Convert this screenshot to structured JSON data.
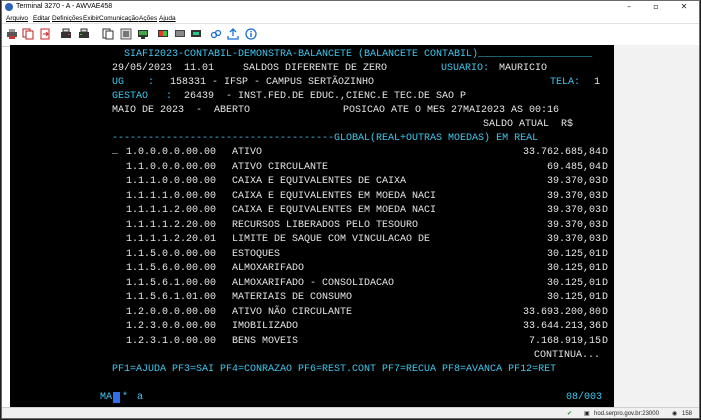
{
  "window": {
    "title": "Terminal 3270 - A - AWVAE458",
    "minimize": "–",
    "maximize": "▫",
    "close": "✕"
  },
  "menu": [
    {
      "label": "Arquivo"
    },
    {
      "label": "Editar"
    },
    {
      "label": "Definições"
    },
    {
      "label": "Exibir"
    },
    {
      "label": "Comunicação"
    },
    {
      "label": "Ações"
    },
    {
      "label": "Ajuda"
    }
  ],
  "toolbar": [
    "print-screen-icon",
    "copy-icon",
    "paste-icon",
    "send-icon",
    "receive-icon",
    "macro-icon",
    "keypad-icon",
    "display-icon",
    "color-icon",
    "settings-icon",
    "link-icon",
    "upload-icon",
    "help-icon"
  ],
  "terminal": {
    "header_line": "  SIAFI2023-CONTABIL-DEMONSTRA-BALANCETE (BALANCETE CONTABIL)___________________",
    "date_time": "29/05/2023  11.01",
    "report_title": "SALDOS DIFERENTE DE ZERO",
    "user_label": "USUARIO:",
    "user_name": "MAURICIO",
    "ug_label": "UG    :",
    "ug_value": "158331 - IFSP - CAMPUS SERTÃOZINHO",
    "screen_label": "TELA:",
    "screen_number": "1",
    "gestao_label": "GESTAO   :",
    "gestao_value": "26439  - INST.FED.DE EDUC.,CIENC.E TEC.DE SAO P",
    "period": "MAIO DE 2023  -  ABERTO",
    "position": "POSICAO ATE O MES 27MAI2023 AS 00:16",
    "balance_header": "SALDO ATUAL  R$",
    "global_line": "-------------------------------------GLOBAL(REAL+OUTRAS MOEDAS) EM REAL",
    "input_marker": "_",
    "rows": [
      {
        "code": "1.0.0.0.0.00.00",
        "name": "ATIVO",
        "value": "33.762.685,84",
        "dc": "D"
      },
      {
        "code": "1.1.0.0.0.00.00",
        "name": "ATIVO CIRCULANTE",
        "value": "69.485,04",
        "dc": "D"
      },
      {
        "code": "1.1.1.0.0.00.00",
        "name": "CAIXA E EQUIVALENTES DE CAIXA",
        "value": "39.370,03",
        "dc": "D"
      },
      {
        "code": "1.1.1.1.0.00.00",
        "name": "CAIXA E EQUIVALENTES EM MOEDA NACI",
        "value": "39.370,03",
        "dc": "D"
      },
      {
        "code": "1.1.1.1.2.00.00",
        "name": "CAIXA E EQUIVALENTES EM MOEDA NACI",
        "value": "39.370,03",
        "dc": "D"
      },
      {
        "code": "1.1.1.1.2.20.00",
        "name": "RECURSOS LIBERADOS PELO TESOURO",
        "value": "39.370,03",
        "dc": "D"
      },
      {
        "code": "1.1.1.1.2.20.01",
        "name": "LIMITE DE SAQUE COM VINCULACAO DE",
        "value": "39.370,03",
        "dc": "D"
      },
      {
        "code": "1.1.5.0.0.00.00",
        "name": "ESTOQUES",
        "value": "30.125,01",
        "dc": "D"
      },
      {
        "code": "1.1.5.6.0.00.00",
        "name": "ALMOXARIFADO",
        "value": "30.125,01",
        "dc": "D"
      },
      {
        "code": "1.1.5.6.1.00.00",
        "name": "ALMOXARIFADO - CONSOLIDACAO",
        "value": "30.125,01",
        "dc": "D"
      },
      {
        "code": "1.1.5.6.1.01.00",
        "name": "MATERIAIS DE CONSUMO",
        "value": "30.125,01",
        "dc": "D"
      },
      {
        "code": "1.2.0.0.0.00.00",
        "name": "ATIVO NÃO CIRCULANTE",
        "value": "33.693.200,80",
        "dc": "D"
      },
      {
        "code": "1.2.3.0.0.00.00",
        "name": "IMOBILIZADO",
        "value": "33.644.213,36",
        "dc": "D"
      },
      {
        "code": "1.2.3.1.0.00.00",
        "name": "BENS MOVEIS",
        "value": "7.168.919,15",
        "dc": "D"
      }
    ],
    "continue_label": "CONTINUA...",
    "pf_keys": "PF1=AJUDA PF3=SAI PF4=CONRAZAO PF6=REST.CONT PF7=RECUA PF8=AVANCA PF12=RET",
    "oia_ma": "MA",
    "oia_indicator": "*",
    "oia_a": "a",
    "oia_cursor_pos": "08/003"
  },
  "status": {
    "host": "hod.serpro.gov.br:23000",
    "session": "158"
  }
}
